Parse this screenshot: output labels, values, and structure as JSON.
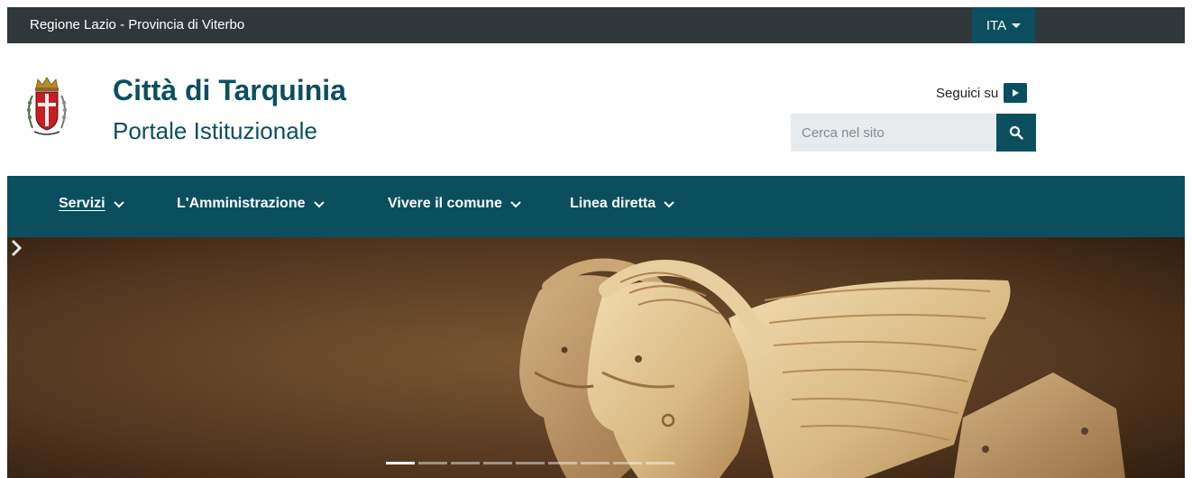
{
  "topbar": {
    "region_text": "Regione Lazio - Provincia di Viterbo",
    "language": "ITA"
  },
  "header": {
    "title": "Città di Tarquinia",
    "subtitle": "Portale Istituzionale",
    "follow_label": "Seguici su",
    "search_placeholder": "Cerca nel sito"
  },
  "nav": {
    "items": [
      {
        "label": "Servizi"
      },
      {
        "label": "L'Amministrazione"
      },
      {
        "label": "Vivere il comune"
      },
      {
        "label": "Linea diretta"
      }
    ]
  },
  "hero": {
    "slide_count": 9,
    "active_slide": 1
  },
  "colors": {
    "topbar": "#30373b",
    "brand": "#0b4f5f",
    "search_bg": "#e7ebed"
  },
  "icons": [
    "crest-logo",
    "youtube-icon",
    "search-icon",
    "chevron-down-icon",
    "chevron-right-icon"
  ]
}
